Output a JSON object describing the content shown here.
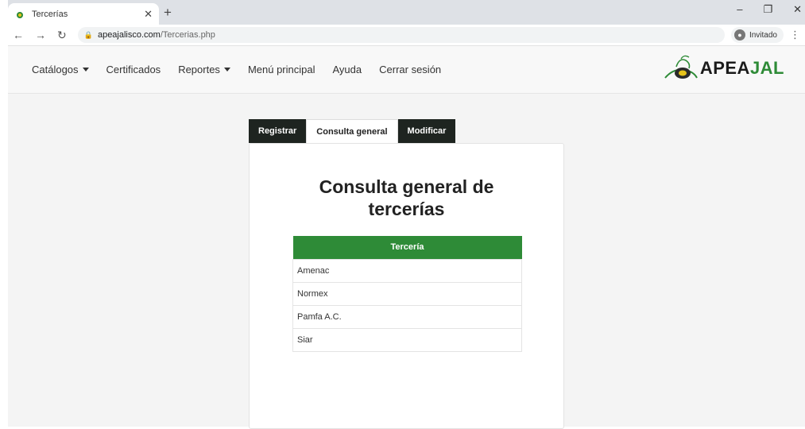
{
  "browser": {
    "tab_title": "Tercerías",
    "new_tab": "+",
    "url_host": "apeajalisco.com",
    "url_path": "/Tercerias.php",
    "profile_label": "Invitado"
  },
  "navbar": {
    "items": [
      {
        "label": "Catálogos",
        "dropdown": true
      },
      {
        "label": "Certificados",
        "dropdown": false
      },
      {
        "label": "Reportes",
        "dropdown": true
      },
      {
        "label": "Menú principal",
        "dropdown": false
      },
      {
        "label": "Ayuda",
        "dropdown": false
      },
      {
        "label": "Cerrar sesión",
        "dropdown": false
      }
    ],
    "brand_prefix": "APEA",
    "brand_suffix": "JAL"
  },
  "tabs": [
    {
      "label": "Registrar",
      "active": false
    },
    {
      "label": "Consulta general",
      "active": true
    },
    {
      "label": "Modificar",
      "active": false
    }
  ],
  "main": {
    "heading_line1": "Consulta general de",
    "heading_line2": "tercerías",
    "table": {
      "header": "Tercería",
      "rows": [
        "Amenac",
        "Normex",
        "Pamfa A.C.",
        "Siar"
      ]
    }
  },
  "colors": {
    "accent_green": "#2e8b37",
    "dark_tab": "#1e2420"
  }
}
